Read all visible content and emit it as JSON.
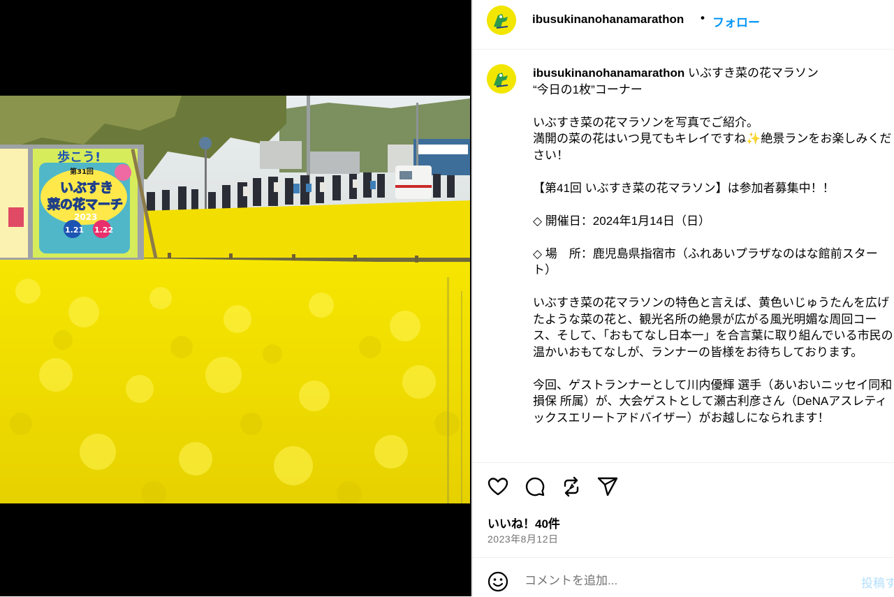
{
  "header": {
    "username": "ibusukinanohanamarathon",
    "separator": "•",
    "follow_label": "フォロー"
  },
  "media": {
    "sign": {
      "badge": "第31回",
      "title_line1": "いぶすき",
      "title_line2": "菜の花マーチ",
      "year": "2023",
      "top_text": "歩こう!",
      "date1": "1.21",
      "date2": "1.22"
    }
  },
  "caption": {
    "username": "ibusukinanohanamarathon",
    "first_line": " いぶすき菜の花マラソン",
    "lines": [
      "“今日の1枚”コーナー",
      "",
      "いぶすき菜の花マラソンを写真でご紹介。",
      "満開の菜の花はいつ見てもキレイですね✨絶景ランをお楽しみください！",
      "",
      "【第41回 いぶすき菜の花マラソン】は参加者募集中！！",
      "",
      "◇ 開催日：2024年1月14日（日）",
      "",
      "◇ 場　所：鹿児島県指宿市（ふれあいプラザなのはな館前スタート）",
      "",
      "いぶすき菜の花マラソンの特色と言えば、黄色いじゅうたんを広げたような菜の花と、観光名所の絶景が広がる風光明媚な周回コース、そして、「おもてなし日本一」を合言葉に取り組んでいる市民の温かいおもてなしが、ランナーの皆様をお待ちしております。",
      "",
      "今回、ゲストランナーとして川内優輝 選手（あいおいニッセイ同和損保 所属）が、大会ゲストとして瀬古利彦さん（DeNAアスレティックスエリートアドバイザー）がお越しになられます！"
    ]
  },
  "actions": {
    "icons": [
      "heart-icon",
      "comment-icon",
      "repost-icon",
      "share-icon"
    ],
    "likes": "いいね！40件",
    "date": "2023年8月12日"
  },
  "comment": {
    "placeholder": "コメントを追加...",
    "post_label": "投稿する"
  },
  "colors": {
    "follow": "#0095f6",
    "post_disabled": "#b2dffc",
    "avatar_bg": "#f2e600",
    "rapeseed": "#f0e000"
  }
}
